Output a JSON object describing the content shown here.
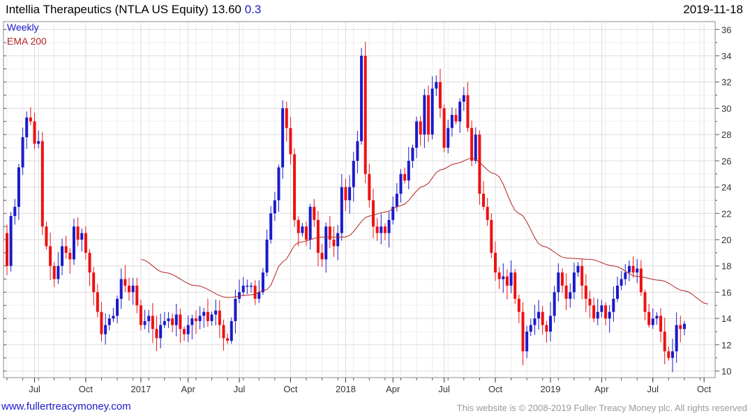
{
  "header": {
    "name": "Intellia Therapeutics (NTLA US Equity)",
    "price": "13.60",
    "change": "0.3",
    "date": "2019-11-18"
  },
  "legend": {
    "series1": "Weekly",
    "series2": "EMA 200"
  },
  "footer": {
    "left": "www.fullertreacymoney.com",
    "right": "This website is © 2008-2019 Fuller Treacy Money plc. All rights reserved"
  },
  "colors": {
    "up": "#1a1acc",
    "down": "#ee1111",
    "ema": "#b22222",
    "grid": "#dcdcdc"
  },
  "chart_data": {
    "type": "candlestick",
    "ylim": [
      9.5,
      36.6
    ],
    "y_ticks": [
      10,
      12,
      14,
      16,
      18,
      20,
      22,
      24,
      26,
      28,
      30,
      32,
      34,
      36
    ],
    "x_ticks": [
      {
        "label": "Jul",
        "w": 7
      },
      {
        "label": "Oct",
        "w": 20
      },
      {
        "label": "2017",
        "w": 34
      },
      {
        "label": "Apr",
        "w": 46
      },
      {
        "label": "Jul",
        "w": 59
      },
      {
        "label": "Oct",
        "w": 72
      },
      {
        "label": "2018",
        "w": 86
      },
      {
        "label": "Apr",
        "w": 98
      },
      {
        "label": "Jul",
        "w": 111
      },
      {
        "label": "Oct",
        "w": 124
      },
      {
        "label": "2019",
        "w": 138
      },
      {
        "label": "Apr",
        "w": 151
      },
      {
        "label": "Jul",
        "w": 164
      },
      {
        "label": "Oct",
        "w": 177
      }
    ],
    "weekly_close": [
      18.0,
      21.8,
      22.5,
      25.5,
      27.8,
      29.3,
      29.0,
      27.3,
      27.5,
      21.0,
      19.5,
      18.0,
      17.0,
      18.0,
      19.5,
      19.0,
      18.5,
      21.0,
      20.0,
      20.5,
      19.0,
      17.5,
      16.0,
      14.5,
      12.8,
      13.5,
      14.0,
      14.2,
      15.5,
      17.0,
      16.5,
      16.0,
      16.5,
      15.0,
      13.5,
      13.8,
      14.2,
      13.2,
      12.5,
      13.5,
      13.8,
      14.0,
      13.5,
      14.3,
      13.2,
      12.8,
      13.5,
      14.0,
      13.8,
      14.2,
      14.5,
      13.8,
      14.3,
      14.6,
      13.5,
      12.5,
      12.3,
      13.8,
      15.5,
      16.0,
      16.5,
      16.5,
      16.5,
      15.5,
      16.0,
      17.5,
      20.0,
      22.0,
      23.0,
      25.5,
      30.0,
      28.5,
      26.5,
      21.5,
      20.5,
      21.0,
      20.0,
      22.5,
      21.5,
      19.0,
      18.5,
      21.0,
      20.0,
      19.5,
      20.5,
      24.0,
      23.0,
      24.0,
      26.0,
      27.5,
      34.0,
      25.0,
      23.0,
      21.0,
      20.5,
      21.0,
      20.5,
      21.5,
      22.5,
      23.5,
      25.0,
      24.5,
      26.0,
      27.0,
      29.0,
      28.0,
      31.0,
      28.0,
      31.5,
      32.0,
      30.0,
      27.0,
      28.5,
      29.5,
      29.0,
      30.5,
      31.0,
      28.5,
      26.0,
      28.0,
      23.5,
      22.5,
      21.5,
      19.0,
      17.5,
      17.0,
      17.2,
      16.5,
      17.5,
      15.5,
      14.5,
      11.5,
      13.0,
      13.5,
      14.0,
      14.5,
      13.5,
      13.0,
      14.2,
      16.0,
      17.5,
      16.5,
      15.5,
      16.0,
      17.5,
      18.0,
      16.5,
      15.5,
      15.0,
      14.0,
      14.5,
      15.0,
      14.0,
      14.5,
      15.5,
      16.5,
      17.0,
      17.5,
      18.0,
      17.5,
      17.8,
      16.0,
      14.5,
      13.5,
      14.0,
      14.2,
      13.0,
      11.5,
      11.0,
      11.5,
      13.5,
      13.2,
      13.6
    ],
    "ema_start_week": 34,
    "ema_knots": [
      [
        34,
        18.5
      ],
      [
        40,
        17.5
      ],
      [
        48,
        16.5
      ],
      [
        56,
        15.6
      ],
      [
        62,
        15.8
      ],
      [
        66,
        16.2
      ],
      [
        70,
        18.3
      ],
      [
        74,
        19.8
      ],
      [
        80,
        20.2
      ],
      [
        86,
        20.2
      ],
      [
        92,
        21.8
      ],
      [
        96,
        22.1
      ],
      [
        100,
        22.6
      ],
      [
        106,
        24.1
      ],
      [
        110,
        25.3
      ],
      [
        114,
        25.8
      ],
      [
        118,
        26.2
      ],
      [
        124,
        25.0
      ],
      [
        130,
        22.0
      ],
      [
        136,
        19.5
      ],
      [
        142,
        18.6
      ],
      [
        148,
        18.5
      ],
      [
        154,
        18.0
      ],
      [
        160,
        17.2
      ],
      [
        166,
        16.9
      ],
      [
        172,
        16.1
      ],
      [
        178,
        15.1
      ]
    ]
  }
}
